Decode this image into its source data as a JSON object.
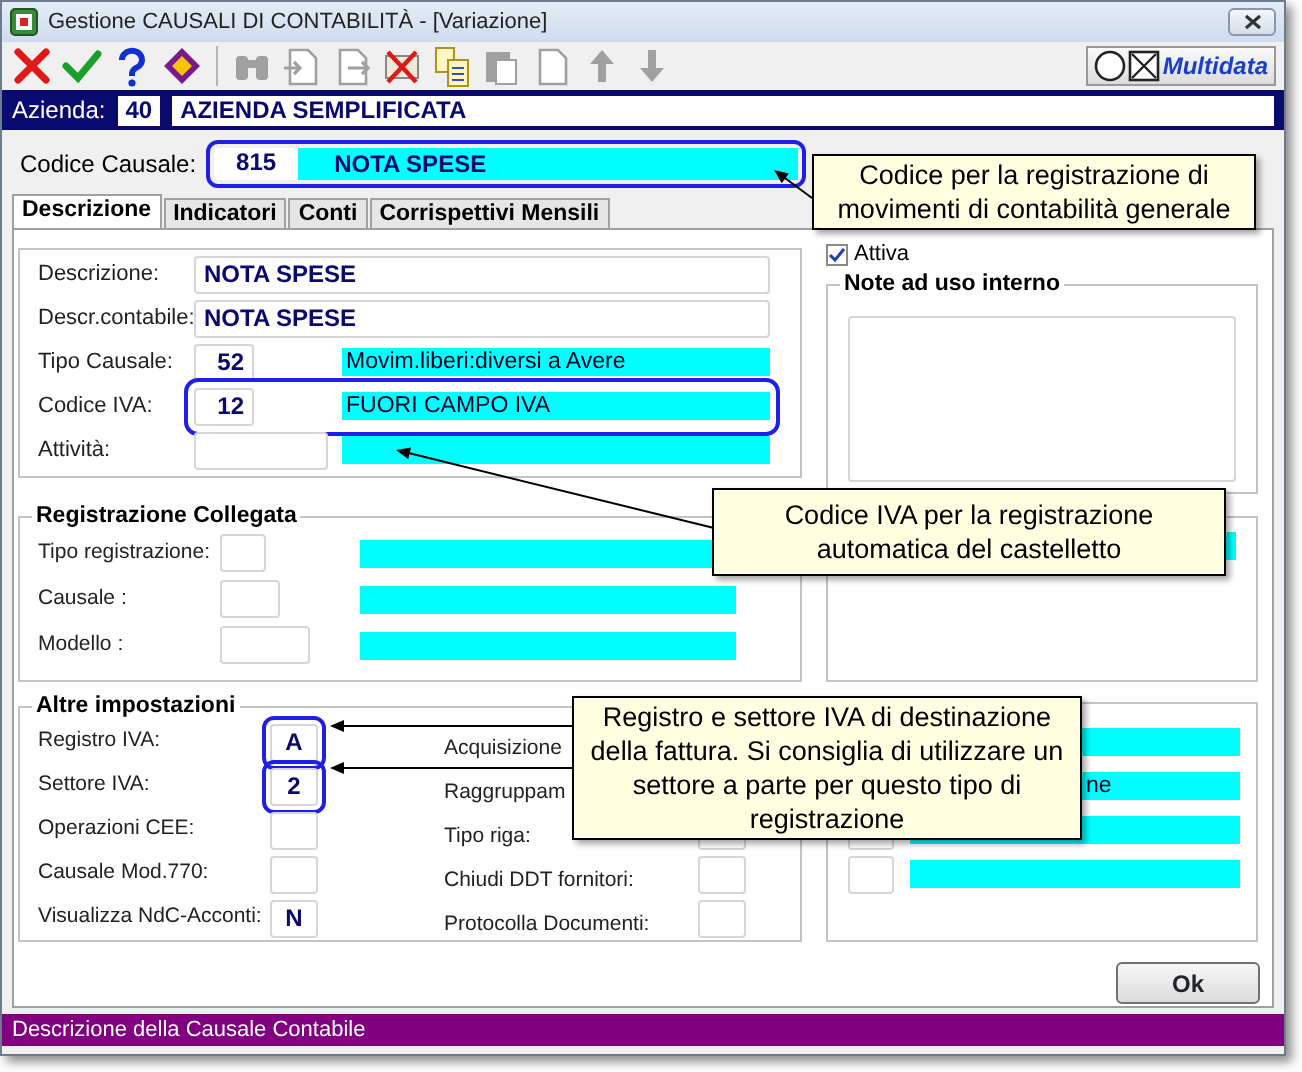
{
  "window": {
    "title": "Gestione CAUSALI DI CONTABILITÀ - [Variazione]"
  },
  "toolbar": [
    {
      "kind": "cancel",
      "disabled": false
    },
    {
      "kind": "confirm",
      "disabled": false
    },
    {
      "kind": "help",
      "disabled": false
    },
    {
      "kind": "special",
      "disabled": false
    },
    {
      "kind": "separator"
    },
    {
      "kind": "search",
      "disabled": true
    },
    {
      "kind": "doc-in",
      "disabled": true
    },
    {
      "kind": "doc-out",
      "disabled": true
    },
    {
      "kind": "delete",
      "disabled": false
    },
    {
      "kind": "copy",
      "disabled": false
    },
    {
      "kind": "paste",
      "disabled": true
    },
    {
      "kind": "new",
      "disabled": true
    },
    {
      "kind": "up",
      "disabled": true
    },
    {
      "kind": "down",
      "disabled": true
    }
  ],
  "brand": "Multidata",
  "azienda": {
    "label": "Azienda:",
    "code": "40",
    "name": "AZIENDA SEMPLIFICATA"
  },
  "codice_causale": {
    "label": "Codice Causale:",
    "code": "815",
    "name": "NOTA SPESE",
    "highlighted": true
  },
  "tabs": [
    {
      "label": "Descrizione",
      "selected": true
    },
    {
      "label": "Indicatori",
      "selected": false
    },
    {
      "label": "Conti",
      "selected": false
    },
    {
      "label": "Corrispettivi Mensili",
      "selected": false
    }
  ],
  "descrizione": [
    {
      "kind": "text",
      "label": "Descrizione:",
      "value": "NOTA SPESE",
      "highlighted": false
    },
    {
      "kind": "text",
      "label": "Descr.contabile:",
      "value": "NOTA SPESE",
      "highlighted": false
    },
    {
      "kind": "lookup",
      "label": "Tipo Causale:",
      "code": "52",
      "description": "Movim.liberi:diversi a Avere",
      "highlighted": false
    },
    {
      "kind": "lookup",
      "label": "Codice IVA:",
      "code": "12",
      "description": "FUORI CAMPO IVA",
      "highlighted": true
    },
    {
      "kind": "lookup",
      "label": "Attività:",
      "highlighted": false
    }
  ],
  "attiva": {
    "label": "Attiva",
    "checked": true
  },
  "note": {
    "title": "Note ad uso interno"
  },
  "registrazione_collegata": {
    "title": "Registrazione Collegata",
    "rows": [
      {
        "label": "Tipo registrazione:"
      },
      {
        "label": "Causale :"
      },
      {
        "label": "Modello :"
      }
    ]
  },
  "altre_impostazioni": {
    "title": "Altre impostazioni",
    "column_1": [
      {
        "label": "Registro IVA:",
        "value": "A",
        "highlighted": true
      },
      {
        "label": "Settore IVA:",
        "value": "2",
        "highlighted": true
      },
      {
        "label": "Operazioni CEE:",
        "highlighted": false
      },
      {
        "label": "Causale Mod.770:",
        "highlighted": false
      },
      {
        "label": "Visualizza NdC-Acconti:",
        "value": "N",
        "highlighted": false
      }
    ],
    "column_2": [
      {
        "kind": "label",
        "label": "Acquisizione"
      },
      {
        "kind": "label",
        "label": "Raggruppam"
      },
      {
        "kind": "field",
        "label": "Tipo riga:"
      },
      {
        "kind": "field",
        "label": "Chiudi DDT fornitori:"
      },
      {
        "kind": "field",
        "label": "Protocolla Documenti:"
      }
    ],
    "column_3": [
      {
        "kind": "bar"
      },
      {
        "kind": "bar",
        "description": "ne"
      },
      {
        "kind": "lookup"
      },
      {
        "kind": "lookup"
      }
    ]
  },
  "callouts": [
    {
      "text": "Codice per la registrazione di movimenti di contabilità generale"
    },
    {
      "text": "Codice IVA per la registrazione automatica del castelletto"
    },
    {
      "text": "Registro e settore IVA di destinazione della fattura. Si consiglia di utilizzare un settore a parte per questo tipo di registrazione"
    }
  ],
  "ok_button": "Ok",
  "status_bar": "Descrizione della Causale Contabile"
}
